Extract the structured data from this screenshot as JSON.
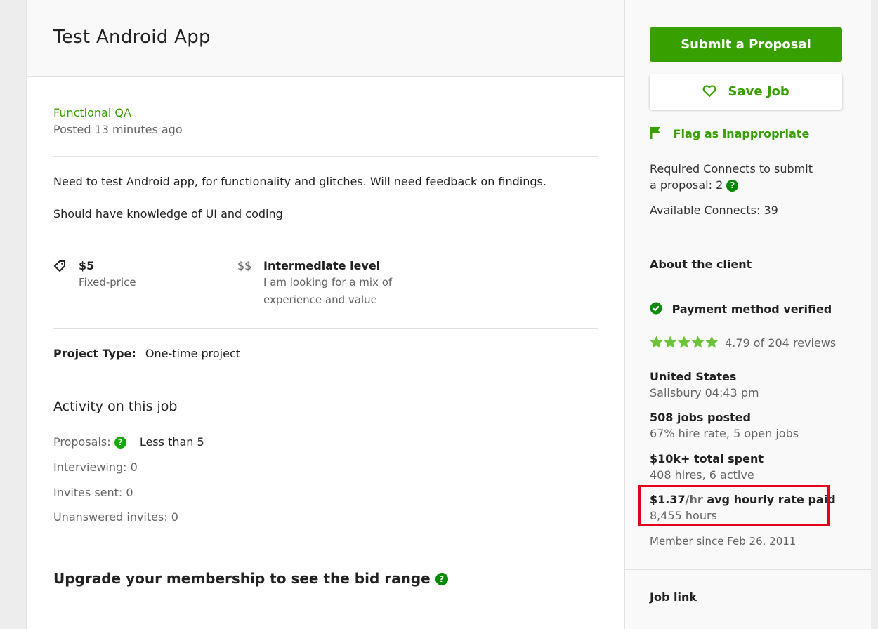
{
  "job": {
    "title": "Test Android App",
    "category": "Functional QA",
    "posted": "Posted 13 minutes ago",
    "description_1": "Need to test Android app, for functionality and glitches. Will need feedback on findings.",
    "description_2": "Should have knowledge of UI and coding",
    "budget": {
      "amount": "$5",
      "type": "Fixed-price"
    },
    "level": {
      "symbol": "$$",
      "name": "Intermediate level",
      "desc_1": "I am looking for a mix of",
      "desc_2": "experience and value"
    },
    "project_type": {
      "label": "Project Type:",
      "value": "One-time project"
    }
  },
  "activity": {
    "heading": "Activity on this job",
    "proposals_label": "Proposals:",
    "proposals_value": "Less than 5",
    "interviewing": "Interviewing: 0",
    "invites_sent": "Invites sent: 0",
    "unanswered": "Unanswered invites: 0"
  },
  "upgrade": {
    "text": "Upgrade your membership to see the bid range"
  },
  "sidebar": {
    "submit_label": "Submit a Proposal",
    "save_label": "Save Job",
    "flag_label": "Flag as inappropriate",
    "connects_required_1": "Required Connects to submit",
    "connects_required_2": "a proposal: 2",
    "connects_available": "Available Connects: 39"
  },
  "client": {
    "heading": "About the client",
    "payment": "Payment method verified",
    "rating": 4.79,
    "rating_text": "4.79 of 204 reviews",
    "country": "United States",
    "city_time": "Salisbury 04:43 pm",
    "jobs_posted": "508 jobs posted",
    "hire_rate": "67% hire rate, 5 open jobs",
    "total_spent": "$10k+ total spent",
    "hires": "408 hires, 6 active",
    "avg_rate_value": "$1.37",
    "avg_rate_unit": "/hr",
    "avg_rate_label": "avg hourly rate paid",
    "hours": "8,455 hours",
    "member_since": "Member since Feb 26, 2011"
  },
  "job_link": {
    "heading": "Job link"
  },
  "colors": {
    "accent": "#37a000",
    "highlight": "#e3001b"
  }
}
